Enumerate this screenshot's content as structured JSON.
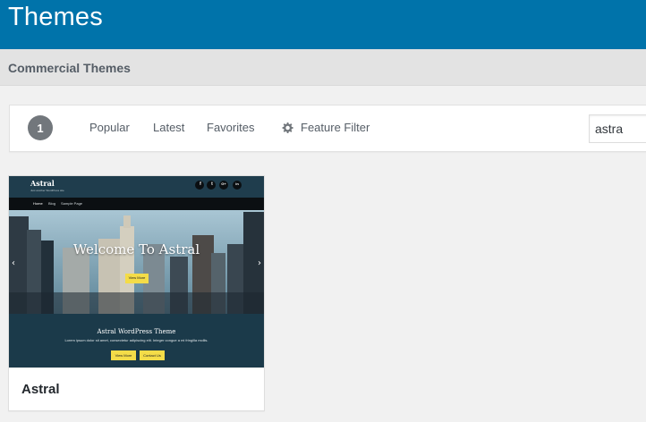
{
  "header": {
    "title": "Themes"
  },
  "subheader": {
    "title": "Commercial Themes"
  },
  "filter_bar": {
    "count": "1",
    "links": [
      "Popular",
      "Latest",
      "Favorites"
    ],
    "feature_filter": "Feature Filter",
    "search_value": "astra",
    "gear_icon": "gear-icon"
  },
  "theme": {
    "name": "Astral",
    "preview": {
      "site_name": "Astral",
      "tagline": "Just another WordPress site",
      "social": [
        "f",
        "t",
        "G+",
        "in"
      ],
      "nav": [
        "Home",
        "Blog",
        "Sample Page"
      ],
      "hero_title": "Welcome To Astral",
      "hero_button": "View More",
      "section_title": "Astral WordPress Theme",
      "section_text": "Lorem ipsum dolor sit amet, consectetur adipiscing elit. Integer congue a mi fringilla mollis.",
      "button_1": "View More",
      "button_2": "Contact Us"
    }
  },
  "colors": {
    "header_bg": "#0073aa",
    "accent_yellow": "#f4dc48",
    "preview_dark": "#1b3a4a"
  }
}
